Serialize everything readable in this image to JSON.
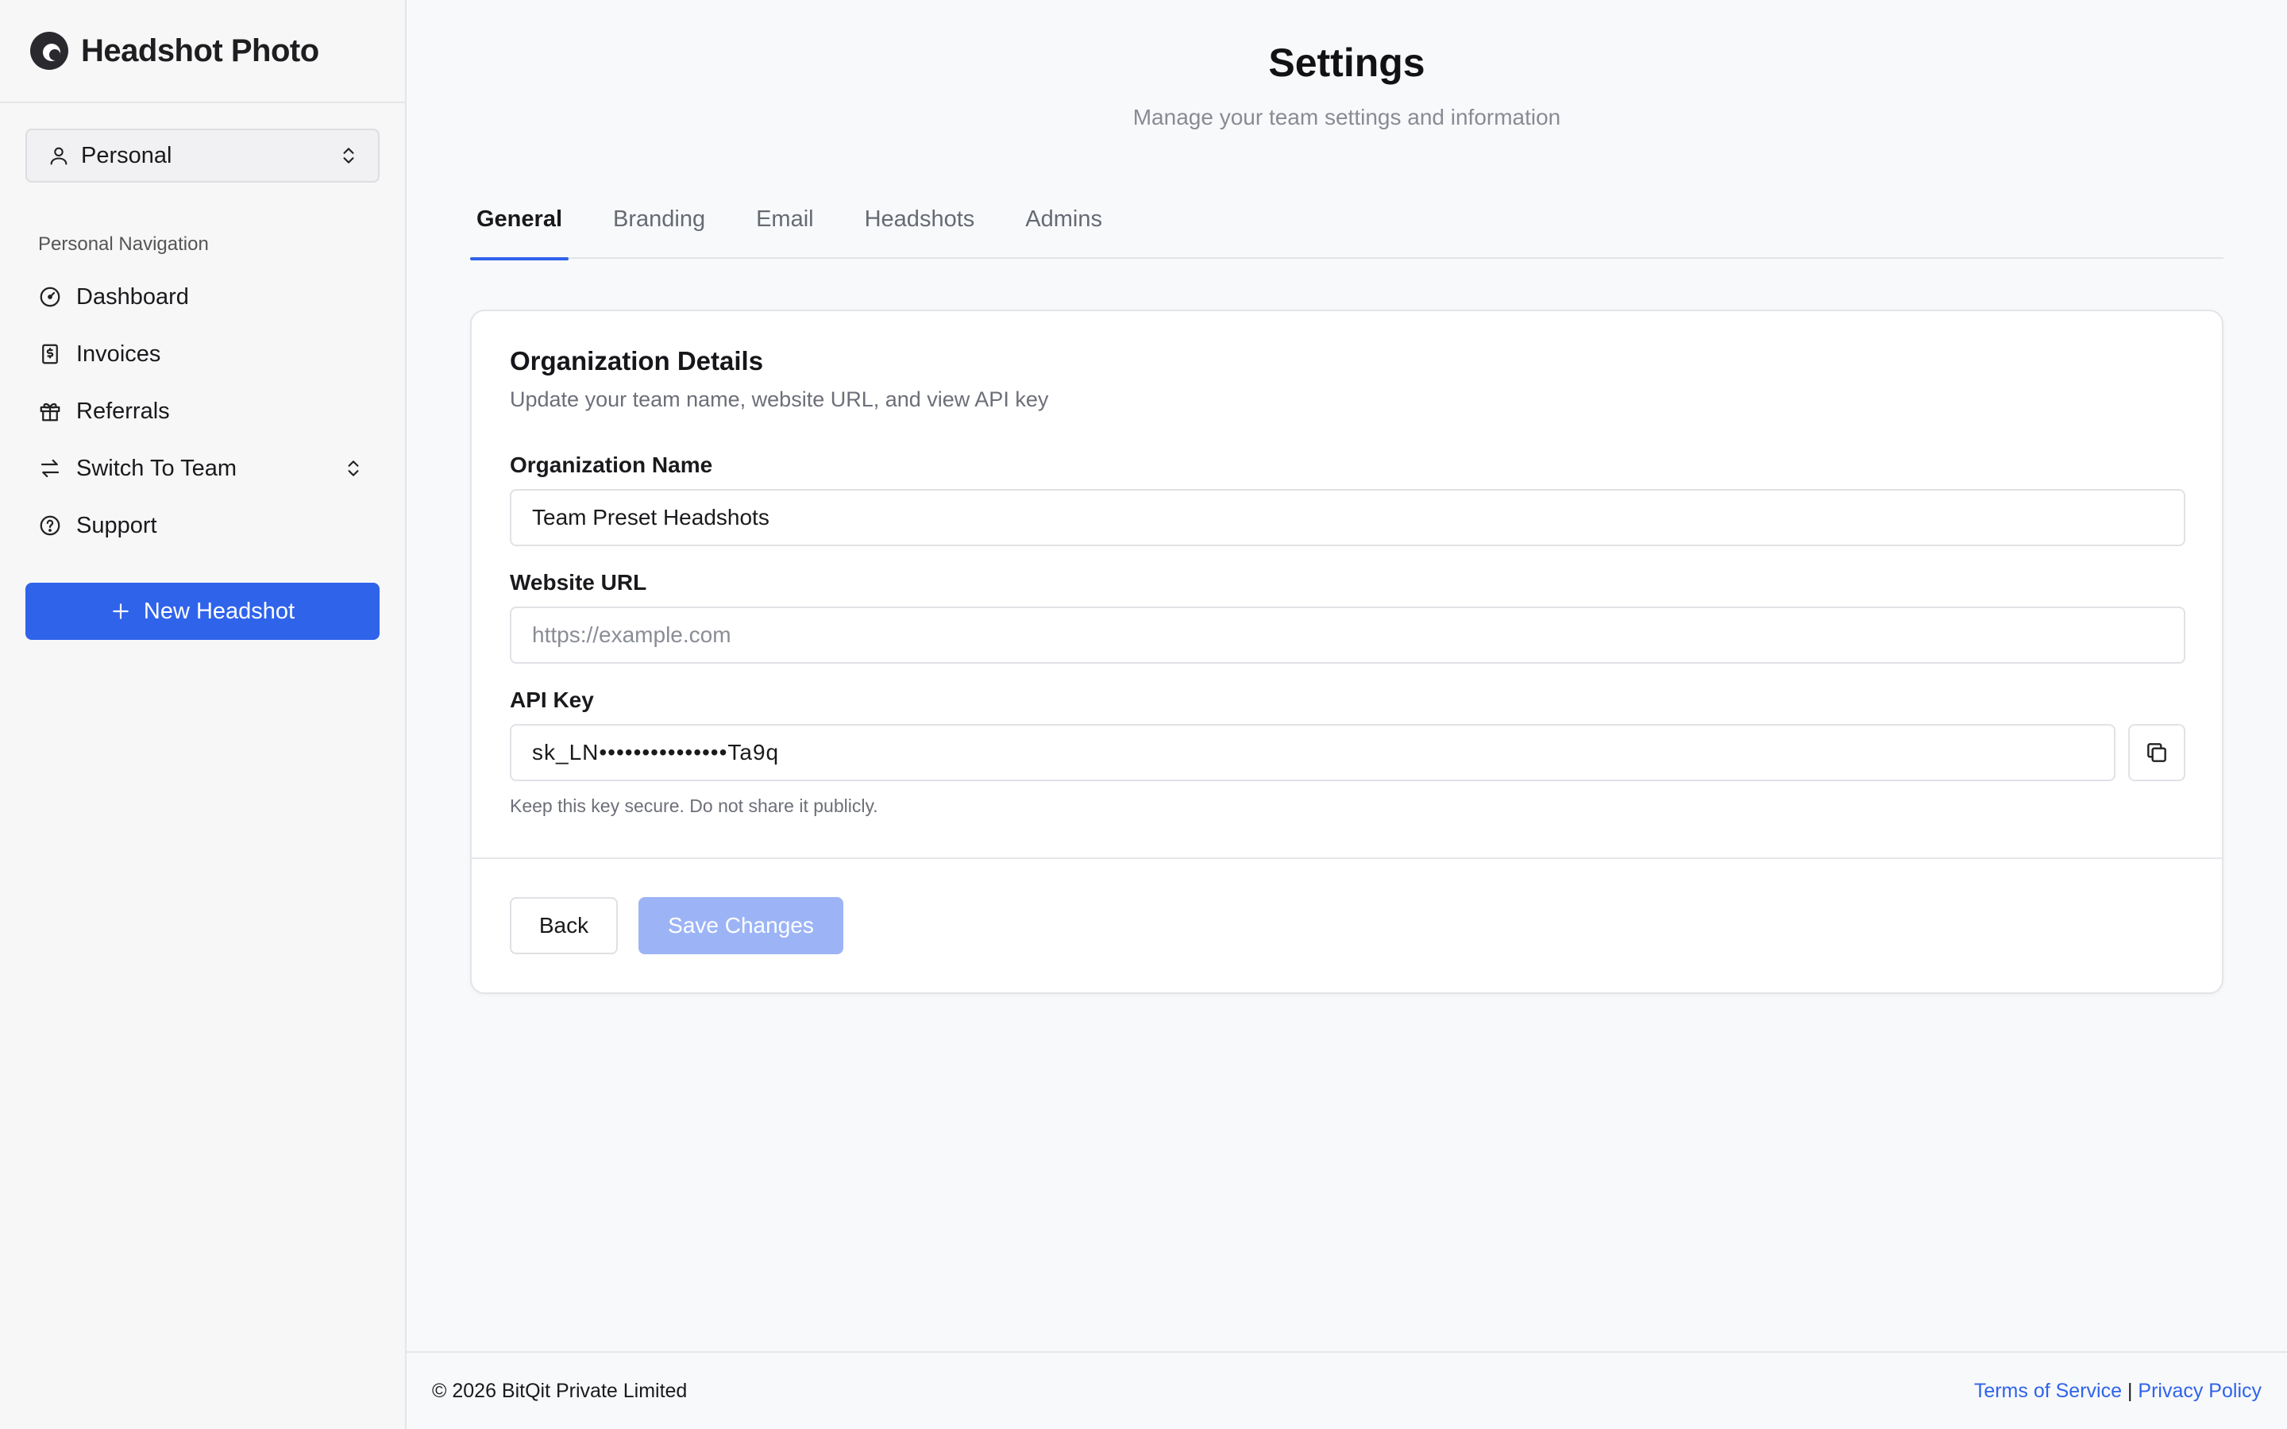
{
  "brand": {
    "name": "Headshot Photo",
    "logo_icon": "headshot-logo-icon"
  },
  "account_selector": {
    "label": "Personal",
    "icon": "user-icon",
    "chevron_icon": "chevron-up-down-icon"
  },
  "sidebar": {
    "heading": "Personal Navigation",
    "items": [
      {
        "label": "Dashboard",
        "icon": "gauge-icon"
      },
      {
        "label": "Invoices",
        "icon": "invoice-icon"
      },
      {
        "label": "Referrals",
        "icon": "gift-icon"
      },
      {
        "label": "Switch To Team",
        "icon": "arrows-swap-icon"
      },
      {
        "label": "Support",
        "icon": "help-circle-icon"
      }
    ],
    "new_button": "New Headshot"
  },
  "page": {
    "title": "Settings",
    "subtitle": "Manage your team settings and information"
  },
  "tabs": [
    {
      "label": "General",
      "active": true
    },
    {
      "label": "Branding",
      "active": false
    },
    {
      "label": "Email",
      "active": false
    },
    {
      "label": "Headshots",
      "active": false
    },
    {
      "label": "Admins",
      "active": false
    }
  ],
  "card": {
    "title": "Organization Details",
    "description": "Update your team name, website URL, and view API key",
    "org_name": {
      "label": "Organization Name",
      "value": "Team Preset Headshots"
    },
    "website": {
      "label": "Website URL",
      "value": "",
      "placeholder": "https://example.com"
    },
    "api_key": {
      "label": "API Key",
      "value": "sk_LN•••••••••••••••Ta9q",
      "hint": "Keep this key secure. Do not share it publicly."
    },
    "back_label": "Back",
    "save_label": "Save Changes"
  },
  "footer": {
    "copyright": "© 2026 BitQit Private Limited",
    "terms": "Terms of Service",
    "separator": "|",
    "privacy": "Privacy Policy"
  },
  "colors": {
    "accent": "#2f63ea",
    "save_disabled": "#9cb4f6"
  }
}
